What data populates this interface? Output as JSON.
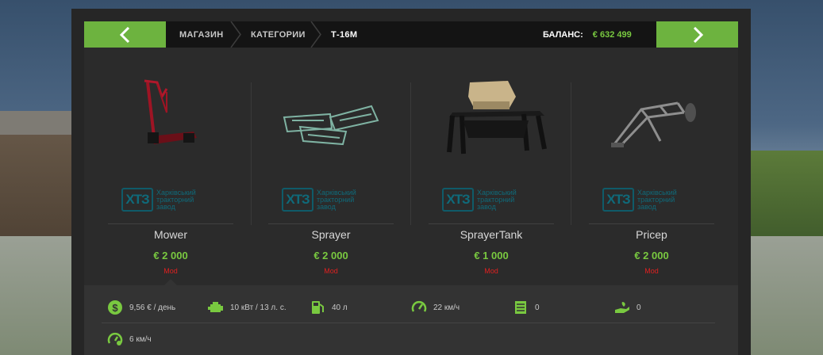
{
  "nav": {
    "back_icon": "chevron-left-icon",
    "next_icon": "chevron-right-icon",
    "breadcrumbs": [
      "МАГАЗИН",
      "КАТЕГОРИИ",
      "Т-16М"
    ],
    "balance_label": "БАЛАНС:",
    "balance_value": "€ 632 499"
  },
  "colors": {
    "accent": "#6db33f",
    "price": "#79c940",
    "mod": "#e02020"
  },
  "brand": {
    "logo_text": "ХТЗ",
    "logo_caption_1": "Харківський",
    "logo_caption_2": "тракторний",
    "logo_caption_3": "завод"
  },
  "items": [
    {
      "name": "Mower",
      "price": "€ 2 000",
      "tag": "Mod"
    },
    {
      "name": "Sprayer",
      "price": "€ 2 000",
      "tag": "Mod"
    },
    {
      "name": "SprayerTank",
      "price": "€ 1 000",
      "tag": "Mod"
    },
    {
      "name": "Pricep",
      "price": "€ 2 000",
      "tag": "Mod"
    }
  ],
  "stats": [
    {
      "icon": "money-icon",
      "value": "9,56 € / день"
    },
    {
      "icon": "engine-icon",
      "value": "10 кВт / 13 л. с."
    },
    {
      "icon": "fuel-icon",
      "value": "40 л"
    },
    {
      "icon": "speedometer-icon",
      "value": "22 км/ч"
    },
    {
      "icon": "capacity-icon",
      "value": "0"
    },
    {
      "icon": "seed-hand-icon",
      "value": "0"
    },
    {
      "icon": "work-speed-icon",
      "value": "6 км/ч"
    }
  ]
}
